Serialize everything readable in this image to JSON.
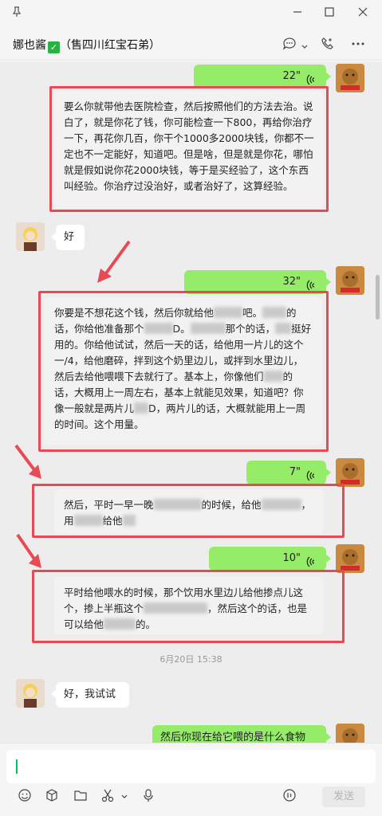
{
  "window": {
    "icons": [
      "pin-icon",
      "minimize-icon",
      "maximize-icon",
      "close-icon"
    ]
  },
  "header": {
    "contact_name": "娜也酱",
    "contact_note": "（售四川红宝石弟）",
    "icons": [
      "chat-bubble-icon",
      "chevron-down-icon",
      "phone-icon",
      "more-icon"
    ]
  },
  "messages": [
    {
      "type": "voice",
      "side": "out",
      "duration": "22\""
    },
    {
      "type": "transcript",
      "side": "out",
      "text": "要么你就带他去医院检查，然后按照他们的方法去治。说白了，就是你花了钱，你可能检查一下800，再给你治疗一下，再花你几百，你干个1000多2000块钱，你都不一定也不一定能好，知道吧。但是啥，但是就是你花，哪怕就是假如说你花2000块钱，等于是买经验了，这个东西叫经验。你治疗过没治好，或者治好了，这算经验。"
    },
    {
      "type": "text",
      "side": "in",
      "text": "好"
    },
    {
      "type": "voice",
      "side": "out",
      "duration": "32\""
    },
    {
      "type": "transcript",
      "side": "out",
      "parts": [
        "你要是不想花这个钱，然后你就给他",
        "吧。",
        "的话，你给他准备那个",
        "D。",
        "那个的话，",
        "挺好用的。你给他试试，然后一天的话，给他用一片儿的这个一/4，给他磨碎，拌到这个奶里边儿，或拌到水里边儿，然后去给他喂喂下去就行了。基本上，你像他们",
        "的话，大概用上一周左右，基本上就能见效果，知道吧？你像一般就是两片儿",
        "D，两片儿的话，大概就能用上一周的时间。这个用量。"
      ]
    },
    {
      "type": "voice",
      "side": "out",
      "duration": "7\""
    },
    {
      "type": "transcript",
      "side": "out",
      "parts": [
        "然后，平时一早一晚",
        "的时候，给他",
        "，用",
        "给他"
      ]
    },
    {
      "type": "voice",
      "side": "out",
      "duration": "10\""
    },
    {
      "type": "transcript",
      "side": "out",
      "parts": [
        "平时给他喂水的时候，那个饮用水里边儿给他掺点儿这个，掺上半瓶这个",
        "，然后这个的话，也是可以给他",
        "的。"
      ]
    },
    {
      "type": "timestamp",
      "text": "6月20日 15:38"
    },
    {
      "type": "text",
      "side": "in",
      "text": "好，我试试"
    },
    {
      "type": "text",
      "side": "out",
      "text": "然后你现在给它喂的是什么食物"
    }
  ],
  "input": {
    "value": ""
  },
  "toolbar": {
    "icons": [
      "emoji-icon",
      "box-icon",
      "folder-icon",
      "scissors-icon",
      "chevron-down-icon",
      "microphone-icon",
      "voice-call-icon"
    ],
    "send_label": "发送"
  },
  "colors": {
    "accent_green": "#95ec69",
    "highlight_red": "#e84a55",
    "chat_bg": "#ededed"
  }
}
